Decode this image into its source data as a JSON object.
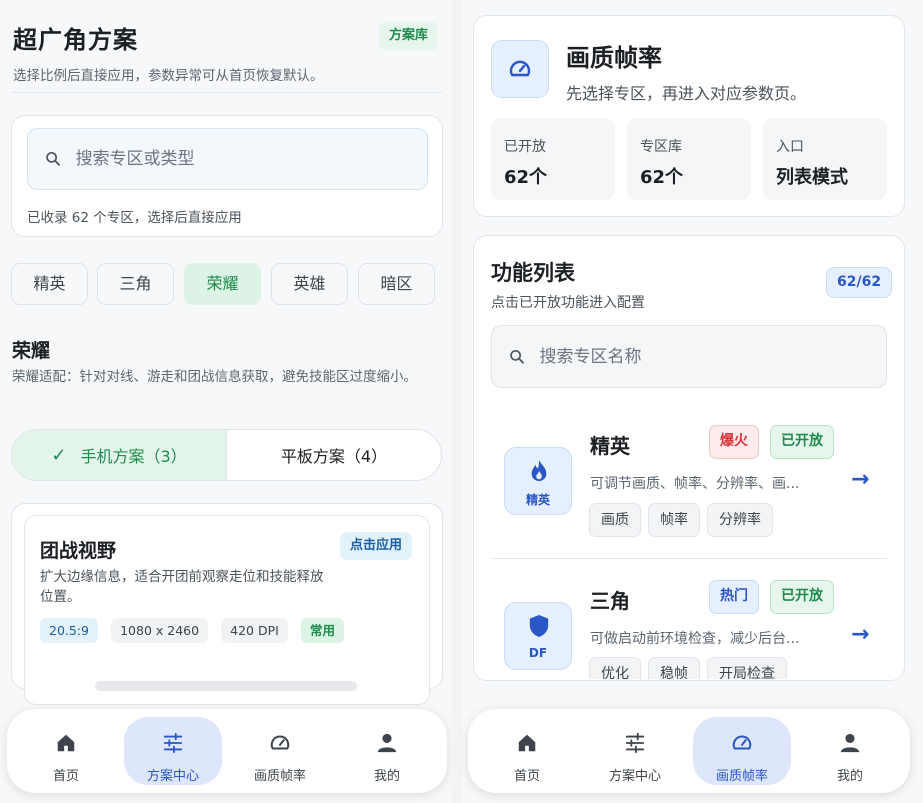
{
  "left": {
    "title": "超广角方案",
    "badge": "方案库",
    "subtitle": "选择比例后直接应用，参数异常可从首页恢复默认。",
    "search": {
      "placeholder": "搜索专区或类型",
      "hint": "已收录 62 个专区，选择后直接应用"
    },
    "chips": [
      {
        "label": "精英"
      },
      {
        "label": "三角"
      },
      {
        "label": "荣耀",
        "active": true
      },
      {
        "label": "英雄"
      },
      {
        "label": "暗区"
      }
    ],
    "section": {
      "title": "荣耀",
      "desc": "荣耀适配：针对对线、游走和团战信息获取，避免技能区过度缩小。"
    },
    "segment": {
      "phone": "手机方案（3）",
      "tablet": "平板方案（4）"
    },
    "plan": {
      "title": "团战视野",
      "apply": "点击应用",
      "desc": "扩大边缘信息，适合开团前观察走位和技能释放位置。",
      "tags": [
        "20.5:9",
        "1080 x 2460",
        "420 DPI",
        "常用"
      ]
    }
  },
  "right": {
    "header": {
      "title": "画质帧率",
      "subtitle": "先选择专区，再进入对应参数页。",
      "stats": [
        {
          "key": "已开放",
          "value": "62个"
        },
        {
          "key": "专区库",
          "value": "62个"
        },
        {
          "key": "入口",
          "value": "列表模式"
        }
      ]
    },
    "list": {
      "title": "功能列表",
      "subtitle": "点击已开放功能进入配置",
      "count": "62/62",
      "search_placeholder": "搜索专区名称",
      "items": [
        {
          "icon_label": "精英",
          "icon": "flame-icon",
          "name": "精英",
          "badge1": "爆火",
          "badge2": "已开放",
          "desc": "可调节画质、帧率、分辨率、画...",
          "tags": [
            "画质",
            "帧率",
            "分辨率"
          ]
        },
        {
          "icon_label": "DF",
          "icon": "shield-icon",
          "name": "三角",
          "badge1": "热门",
          "badge2": "已开放",
          "desc": "可做启动前环境检查，减少后台...",
          "tags": [
            "优化",
            "稳帧",
            "开局检查"
          ]
        }
      ]
    }
  },
  "nav": {
    "items": [
      "首页",
      "方案中心",
      "画质帧率",
      "我的"
    ]
  },
  "colors": {
    "green": "#1f8a4c",
    "blue": "#2a56c6",
    "red": "#d9363e"
  }
}
